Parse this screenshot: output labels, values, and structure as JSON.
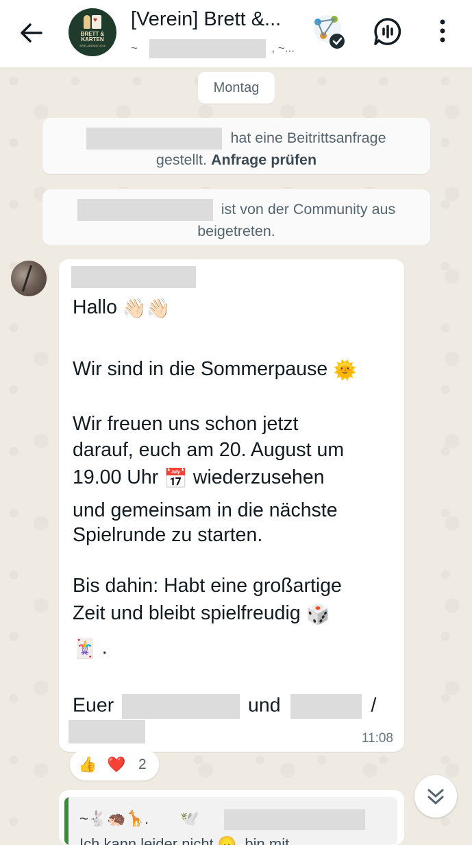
{
  "header": {
    "title": "[Verein] Brett &...",
    "subtitle_prefix": "~",
    "subtitle_suffix": ", ~...",
    "avatar_text": "BRETT & KARTEN",
    "avatar_small_text": "SPIELABENDE 2016"
  },
  "chat": {
    "date_chip": "Montag",
    "system_message_1": {
      "text_a": "hat eine Beitrittsanfrage",
      "text_b": "gestellt.",
      "link": "Anfrage prüfen"
    },
    "system_message_2": {
      "text_a": "ist von der Community aus",
      "text_b": "beigetreten."
    },
    "message": {
      "line1": "Hallo",
      "line2": "Wir sind in die Sommerpause",
      "line3": "Wir freuen uns schon jetzt",
      "line4": "darauf, euch am 20. August um",
      "line5a": "19.00 Uhr",
      "line5b": "wiederzusehen",
      "line6": "und gemeinsam in die nächste",
      "line7": "Spielrunde zu starten.",
      "line8": "Bis dahin: Habt eine großartige",
      "line9": "Zeit und bleibt spielfreudig",
      "line10": ".",
      "line11a": "Euer",
      "line11b": "und",
      "line11c": "/",
      "time": "11:08",
      "emoji_wave": "👋🏻👋🏻",
      "emoji_sun": "🌞",
      "emoji_calendar": "📅",
      "emoji_dice": "🎲",
      "emoji_card": "🃏"
    },
    "reactions": {
      "thumbs": "👍",
      "heart": "❤️",
      "count": "2"
    },
    "next_message": {
      "quote_line1": "~🐇🦔🦒.",
      "quote_line1b": "🕊️",
      "quote_line2": "Ich kann leider nicht 😞, bin mit"
    }
  },
  "colors": {
    "background": "#efeae2",
    "bubble": "#ffffff",
    "accent_green": "#3a8a3a"
  }
}
